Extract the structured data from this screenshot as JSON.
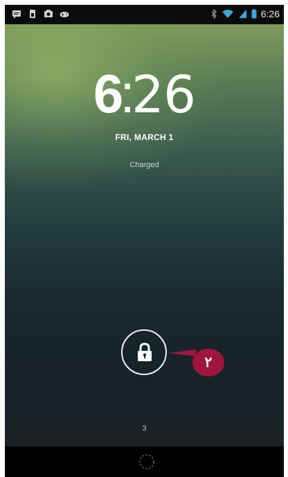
{
  "status_bar": {
    "left_icons": [
      "message-icon",
      "sim-icon",
      "camera-icon",
      "gamepad-icon"
    ],
    "right_icons": [
      "bluetooth-icon",
      "wifi-icon",
      "signal-icon",
      "battery-icon"
    ],
    "time": "6:26"
  },
  "lockscreen": {
    "clock_hour": "6",
    "clock_separator": ":",
    "clock_minutes": "26",
    "date": "FRI, MARCH 1",
    "charging_status": "Charged",
    "unlock_icon": "lock-icon",
    "callout_badge": "۲",
    "page_indicator": "3"
  },
  "nav_bar": {
    "icon": "dotted-circle-icon"
  },
  "colors": {
    "badge": "#a0153f",
    "status_bar_bg": "#0b0b0b"
  }
}
